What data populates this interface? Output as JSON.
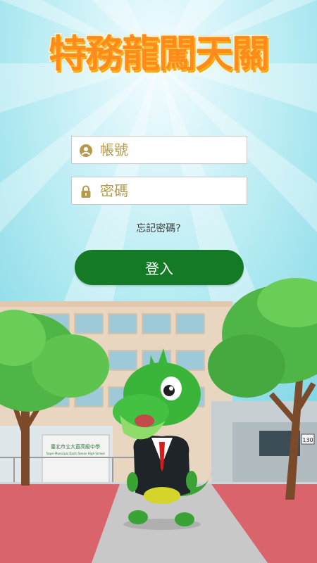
{
  "app": {
    "title": "特務龍闖天關"
  },
  "form": {
    "username": {
      "value": "",
      "placeholder": "帳號",
      "icon": "user-icon"
    },
    "password": {
      "value": "",
      "placeholder": "密碼",
      "icon": "lock-icon"
    },
    "forgot_label": "忘記密碼?",
    "login_label": "登入"
  },
  "scene": {
    "school_sign": "臺北市立大直高級中學",
    "school_sign_en": "Taipei Municipal Dazhi Senior High School",
    "house_number": "130"
  },
  "colors": {
    "accent": "#157a25",
    "title": "#ff8c1a",
    "sky": "#9ee1ee"
  }
}
